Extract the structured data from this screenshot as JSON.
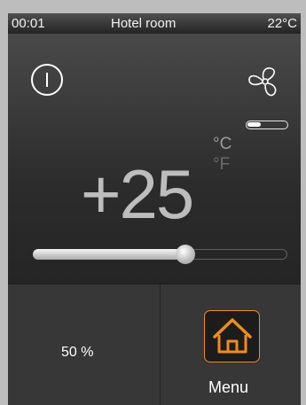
{
  "status": {
    "time": "00:01",
    "title": "Hotel room",
    "temperature": "22°C"
  },
  "climate": {
    "setpoint": "+25",
    "unit_c": "°C",
    "unit_f": "°F",
    "setpoint_slider_fraction": 0.6,
    "fan_speed_fraction": 0.35
  },
  "bottom": {
    "percentage": "50 %",
    "menu_label": "Menu"
  },
  "icons": {
    "power": "power-icon",
    "fan": "fan-icon",
    "home": "home-icon"
  },
  "colors": {
    "accent": "#f08c1a"
  }
}
